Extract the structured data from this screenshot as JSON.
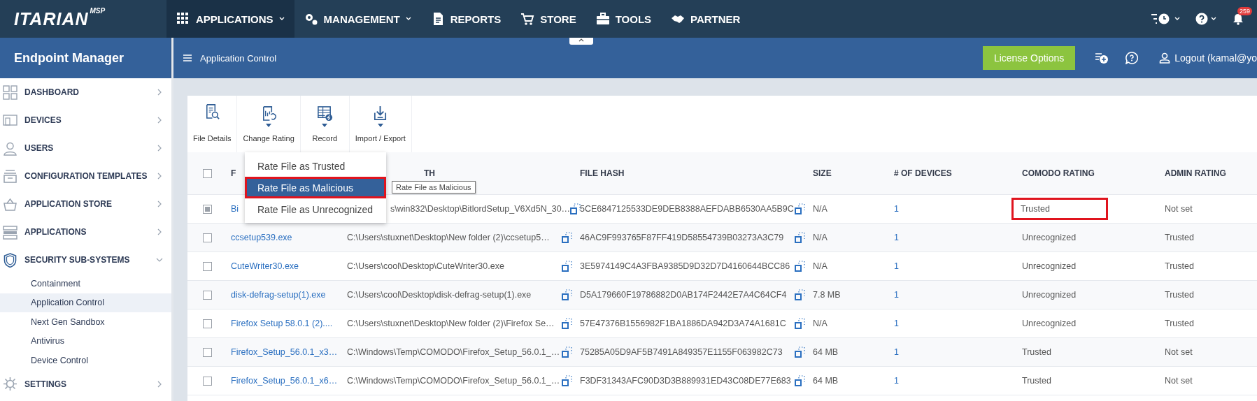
{
  "header": {
    "logo": "ITARIAN",
    "logo_badge": "MSP",
    "nav": [
      {
        "label": "APPLICATIONS",
        "selected": true,
        "has_menu": true
      },
      {
        "label": "MANAGEMENT",
        "selected": false,
        "has_menu": true
      },
      {
        "label": "REPORTS",
        "selected": false,
        "has_menu": false
      },
      {
        "label": "STORE",
        "selected": false,
        "has_menu": false
      },
      {
        "label": "TOOLS",
        "selected": false,
        "has_menu": false
      },
      {
        "label": "PARTNER",
        "selected": false,
        "has_menu": false
      }
    ],
    "notifications": "259"
  },
  "sidebar": {
    "title": "Endpoint Manager",
    "items": [
      {
        "label": "DASHBOARD",
        "expanded": false
      },
      {
        "label": "DEVICES",
        "expanded": false
      },
      {
        "label": "USERS",
        "expanded": false
      },
      {
        "label": "CONFIGURATION TEMPLATES",
        "expanded": false
      },
      {
        "label": "APPLICATION STORE",
        "expanded": false
      },
      {
        "label": "APPLICATIONS",
        "expanded": false
      },
      {
        "label": "SECURITY SUB-SYSTEMS",
        "expanded": true,
        "children": [
          {
            "label": "Containment",
            "selected": false
          },
          {
            "label": "Application Control",
            "selected": true
          },
          {
            "label": "Next Gen Sandbox",
            "selected": false
          },
          {
            "label": "Antivirus",
            "selected": false
          },
          {
            "label": "Device Control",
            "selected": false
          }
        ]
      },
      {
        "label": "SETTINGS",
        "expanded": false
      }
    ]
  },
  "page_bar": {
    "title": "Application Control",
    "license_button": "License Options",
    "logout": "Logout (kamal@yo"
  },
  "toolbar": [
    {
      "label": "File Details",
      "has_menu": false
    },
    {
      "label": "Change Rating",
      "has_menu": true
    },
    {
      "label": "Record",
      "has_menu": true
    },
    {
      "label": "Import / Export",
      "has_menu": true
    }
  ],
  "dropdown": {
    "items": [
      {
        "label": "Rate File as Trusted",
        "selected": false,
        "highlighted": false
      },
      {
        "label": "Rate File as Malicious",
        "selected": true,
        "highlighted": true
      },
      {
        "label": "Rate File as Unrecognized",
        "selected": false,
        "highlighted": false
      }
    ],
    "tooltip": "Rate File as Malicious"
  },
  "table": {
    "select_all_checked": false,
    "columns": [
      "F",
      "TH",
      "FILE HASH",
      "SIZE",
      "# OF DEVICES",
      "COMODO RATING",
      "ADMIN RATING"
    ],
    "rows": [
      {
        "checked": true,
        "name": "Bi",
        "path": "s\\win832\\Desktop\\BitlordSetup_V6Xd5N_30…",
        "hash": "5CE6847125533DE9DEB8388AEFDABB6530AA5B9C",
        "size": "N/A",
        "devices": "1",
        "comodo_rating": "Trusted",
        "admin_rating": "Not set",
        "highlighted": true
      },
      {
        "checked": false,
        "name": "ccsetup539.exe",
        "path": "C:\\Users\\stuxnet\\Desktop\\New folder (2)\\ccsetup5…",
        "hash": "46AC9F993765F87FF419D58554739B03273A3C79",
        "size": "N/A",
        "devices": "1",
        "comodo_rating": "Unrecognized",
        "admin_rating": "Trusted",
        "highlighted": false
      },
      {
        "checked": false,
        "name": "CuteWriter30.exe",
        "path": "C:\\Users\\cool\\Desktop\\CuteWriter30.exe",
        "hash": "3E5974149C4A3FBA9385D9D32D7D4160644BCC86",
        "size": "N/A",
        "devices": "1",
        "comodo_rating": "Unrecognized",
        "admin_rating": "Trusted",
        "highlighted": false
      },
      {
        "checked": false,
        "name": "disk-defrag-setup(1).exe",
        "path": "C:\\Users\\cool\\Desktop\\disk-defrag-setup(1).exe",
        "hash": "D5A179660F19786882D0AB174F2442E7A4C64CF4",
        "size": "7.8 MB",
        "devices": "1",
        "comodo_rating": "Unrecognized",
        "admin_rating": "Trusted",
        "highlighted": false
      },
      {
        "checked": false,
        "name": "Firefox Setup 58.0.1 (2)....",
        "path": "C:\\Users\\stuxnet\\Desktop\\New folder (2)\\Firefox Se…",
        "hash": "57E47376B1556982F1BA1886DA942D3A74A1681C",
        "size": "N/A",
        "devices": "1",
        "comodo_rating": "Unrecognized",
        "admin_rating": "Trusted",
        "highlighted": false
      },
      {
        "checked": false,
        "name": "Firefox_Setup_56.0.1_x3…",
        "path": "C:\\Windows\\Temp\\COMODO\\Firefox_Setup_56.0.1_…",
        "hash": "75285A05D9AF5B7491A849357E1155F063982C73",
        "size": "64 MB",
        "devices": "1",
        "comodo_rating": "Trusted",
        "admin_rating": "Not set",
        "highlighted": false
      },
      {
        "checked": false,
        "name": "Firefox_Setup_56.0.1_x6…",
        "path": "C:\\Windows\\Temp\\COMODO\\Firefox_Setup_56.0.1_…",
        "hash": "F3DF31343AFC90D3D3B889931ED43C08DE77E683",
        "size": "64 MB",
        "devices": "1",
        "comodo_rating": "Trusted",
        "admin_rating": "Not set",
        "highlighted": false
      }
    ]
  }
}
